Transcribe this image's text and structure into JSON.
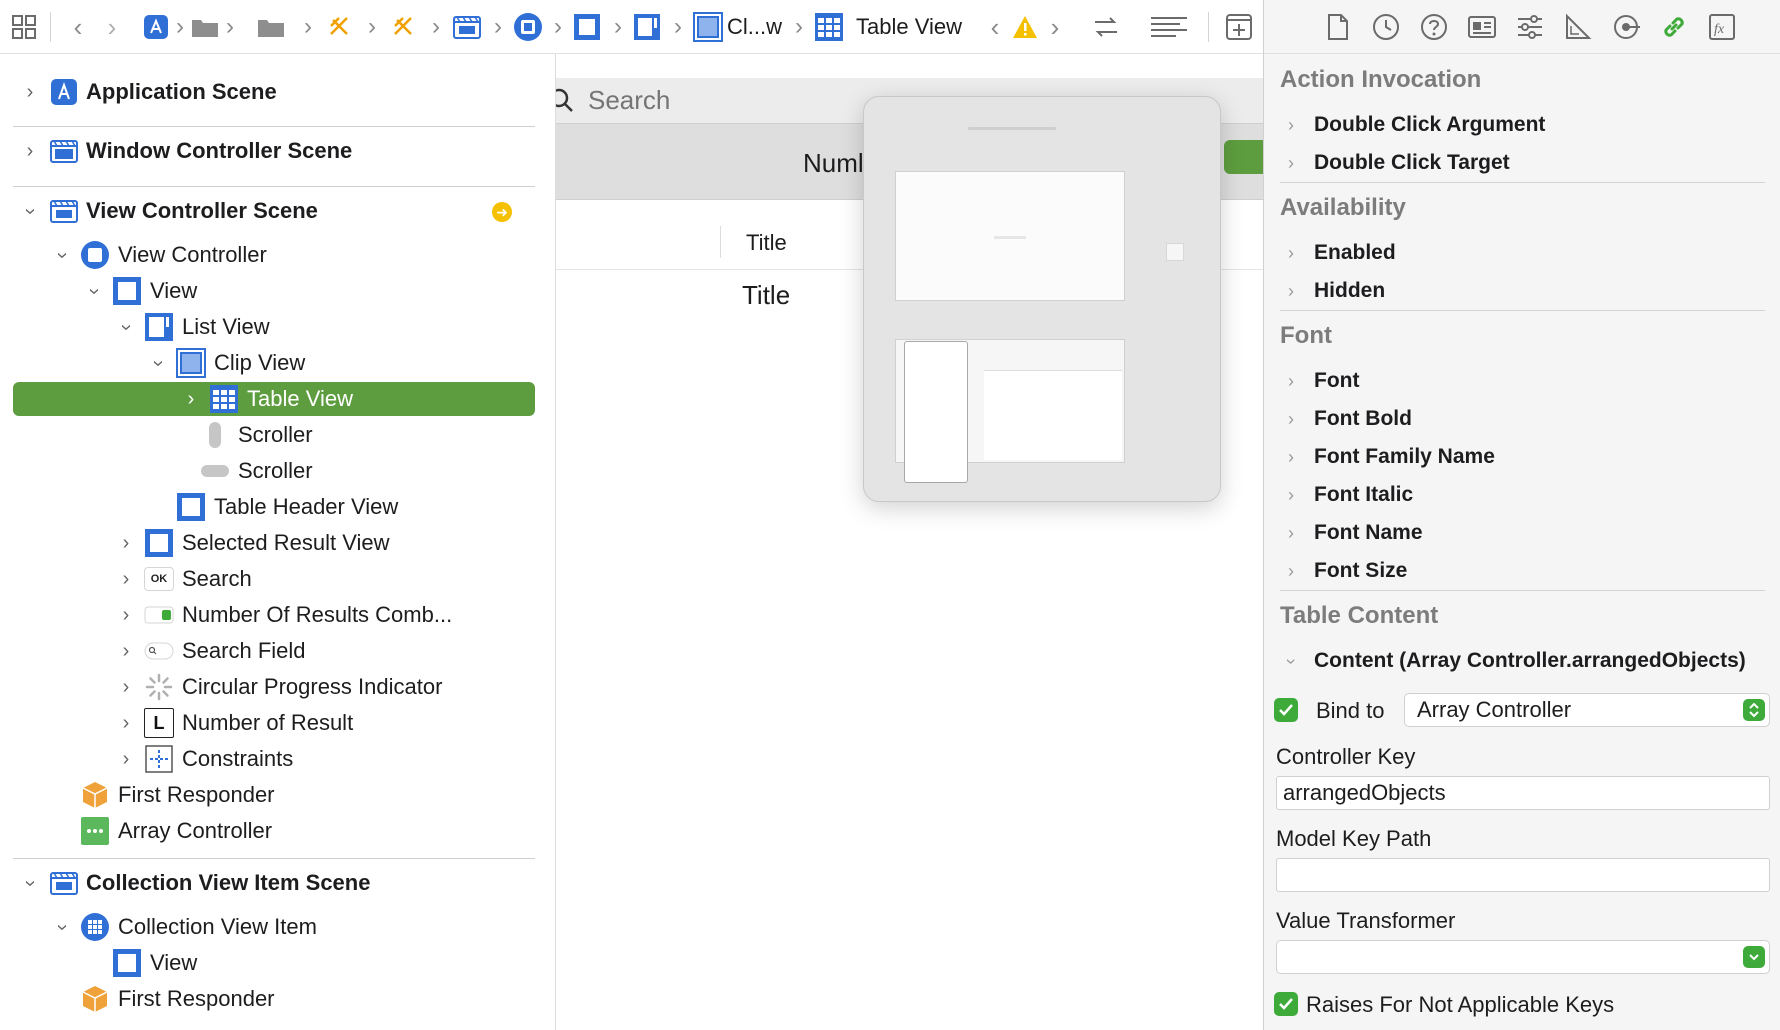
{
  "jumpbar": {
    "crumb_clip": "Cl...w",
    "crumb_table": "Table View"
  },
  "outline": {
    "application_scene": "Application Scene",
    "window_controller_scene": "Window Controller Scene",
    "view_controller_scene": "View Controller Scene",
    "view_controller": "View Controller",
    "view": "View",
    "list_view": "List View",
    "clip_view": "Clip View",
    "table_view": "Table View",
    "scroller_v": "Scroller",
    "scroller_h": "Scroller",
    "table_header_view": "Table Header View",
    "selected_result_view": "Selected Result View",
    "search": "Search",
    "number_of_results_combo": "Number Of Results Comb...",
    "search_field": "Search Field",
    "circular_progress": "Circular Progress Indicator",
    "number_of_result": "Number of Result",
    "constraints": "Constraints",
    "first_responder": "First Responder",
    "array_controller": "Array Controller",
    "collection_view_item_scene": "Collection View Item Scene",
    "collection_view_item": "Collection View Item",
    "view_2": "View",
    "first_responder_2": "First Responder",
    "ok_badge": "OK",
    "l_badge": "L"
  },
  "canvas": {
    "search_placeholder": "Search",
    "num_label": "Numl",
    "column_header": "Title",
    "cell_title": "Title"
  },
  "inspector": {
    "sections": {
      "action_invocation": "Action Invocation",
      "availability": "Availability",
      "font": "Font",
      "table_content": "Table Content"
    },
    "action_items": [
      "Double Click Argument",
      "Double Click Target"
    ],
    "availability_items": [
      "Enabled",
      "Hidden"
    ],
    "font_items": [
      "Font",
      "Font Bold",
      "Font Family Name",
      "Font Italic",
      "Font Name",
      "Font Size"
    ],
    "content_binding": "Content (Array Controller.arrangedObjects)",
    "bind_to_label": "Bind to",
    "bind_to_value": "Array Controller",
    "controller_key_label": "Controller Key",
    "controller_key_value": "arrangedObjects",
    "model_key_path_label": "Model Key Path",
    "model_key_path_value": "",
    "value_transformer_label": "Value Transformer",
    "value_transformer_value": "",
    "raises_label": "Raises For Not Applicable Keys"
  },
  "colors": {
    "selection": "#5e9d3f",
    "accent_blue": "#2f6fd6",
    "checkbox": "#3daa3a",
    "warning": "#f5c000"
  }
}
